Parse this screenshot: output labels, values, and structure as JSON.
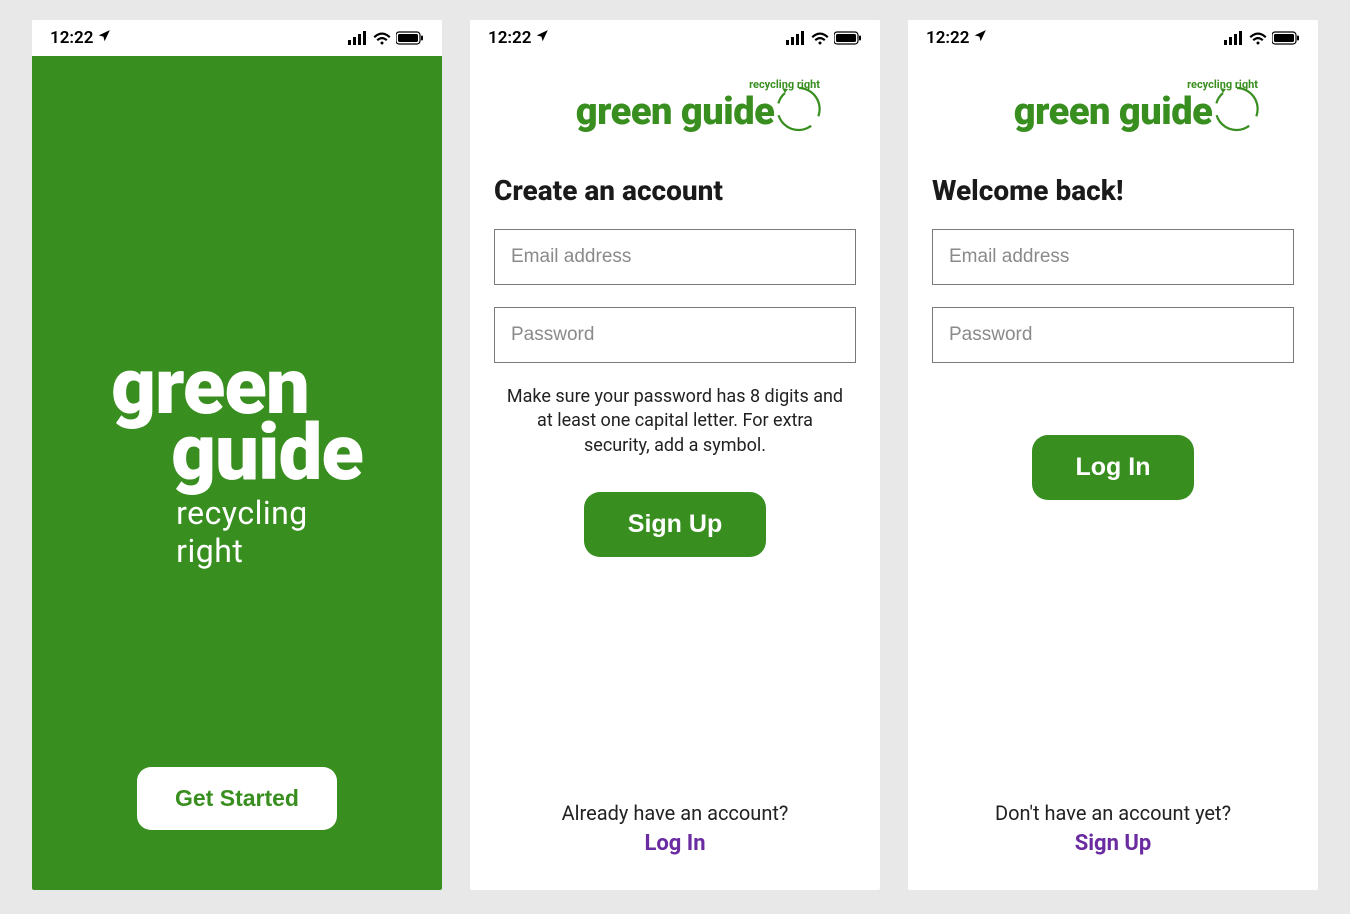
{
  "status": {
    "time": "12:22"
  },
  "brand": {
    "name_line1": "green",
    "name_line2": "guide",
    "name_inline": "green guide",
    "tagline": "recycling right",
    "color_primary": "#388e1f",
    "color_link": "#6a2ca0"
  },
  "screen1": {
    "cta": "Get Started"
  },
  "screen2": {
    "heading": "Create an account",
    "email_placeholder": "Email address",
    "password_placeholder": "Password",
    "hint": "Make sure your password has 8 digits and at least one capital letter. For extra security, add a symbol.",
    "submit": "Sign Up",
    "footer_prompt": "Already have an account?",
    "footer_link": "Log In"
  },
  "screen3": {
    "heading": "Welcome back!",
    "email_placeholder": "Email address",
    "password_placeholder": "Password",
    "submit": "Log In",
    "footer_prompt": "Don't have an account yet?",
    "footer_link": "Sign Up"
  }
}
